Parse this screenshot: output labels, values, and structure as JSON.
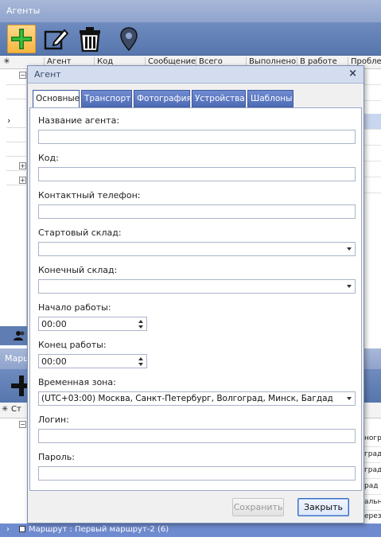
{
  "window": {
    "title": "Агенты"
  },
  "toolbar": {
    "icons": [
      "add-icon",
      "edit-icon",
      "delete-icon",
      "location-pin-icon"
    ]
  },
  "grid": {
    "columns": [
      "Агент",
      "Код",
      "Сообщение",
      "Всего",
      "Выполнено",
      "В работе",
      "Пробле"
    ]
  },
  "section2": {
    "title": "Марш",
    "header_stub": "Ст",
    "row_fragments": [
      "ногр",
      "град",
      "град",
      "рад",
      "альн",
      "ерез"
    ]
  },
  "route_bar": {
    "label": "Маршрут : Первый маршрут-2 (6)"
  },
  "dialog": {
    "title": "Агент",
    "close": "×",
    "tabs": [
      "Основные",
      "Транспорт",
      "Фотография",
      "Устройства",
      "Шаблоны"
    ],
    "active_tab": 0,
    "fields": {
      "name": {
        "label": "Название агента:",
        "value": ""
      },
      "code": {
        "label": "Код:",
        "value": ""
      },
      "phone": {
        "label": "Контактный телефон:",
        "value": ""
      },
      "start_warehouse": {
        "label": "Стартовый склад:",
        "value": ""
      },
      "end_warehouse": {
        "label": "Конечный склад:",
        "value": ""
      },
      "start_time": {
        "label": "Начало работы:",
        "value": "00:00"
      },
      "end_time": {
        "label": "Конец работы:",
        "value": "00:00"
      },
      "timezone": {
        "label": "Временная зона:",
        "value": "(UTC+03:00) Москва, Санкт-Петербург, Волгоград, Минск, Багдад"
      },
      "login": {
        "label": "Логин:",
        "value": ""
      },
      "password": {
        "label": "Пароль:",
        "value": ""
      }
    },
    "buttons": {
      "save": "Сохранить",
      "close": "Закрыть"
    }
  }
}
